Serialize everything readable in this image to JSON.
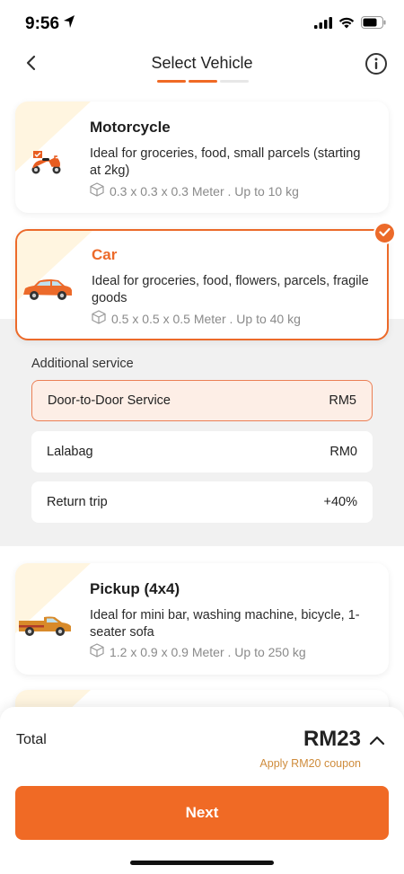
{
  "status": {
    "time": "9:56"
  },
  "header": {
    "title": "Select Vehicle"
  },
  "vehicles": [
    {
      "name": "Motorcycle",
      "description": "Ideal for groceries, food, small parcels (starting at 2kg)",
      "spec": "0.3 x 0.3 x 0.3 Meter . Up to 10 kg"
    },
    {
      "name": "Car",
      "description": "Ideal for groceries, food, flowers, parcels, fragile goods",
      "spec": "0.5 x 0.5 x 0.5 Meter . Up to 40 kg"
    },
    {
      "name": "Pickup (4x4)",
      "description": "Ideal for mini bar, washing machine, bicycle, 1-seater sofa",
      "spec": "1.2 x 0.9 x 0.9 Meter . Up to 250 kg"
    }
  ],
  "additional": {
    "title": "Additional service",
    "services": [
      {
        "label": "Door-to-Door Service",
        "price": "RM5"
      },
      {
        "label": "Lalabag",
        "price": "RM0"
      },
      {
        "label": "Return trip",
        "price": "+40%"
      }
    ]
  },
  "footer": {
    "total_label": "Total",
    "total_amount": "RM23",
    "coupon_text": "Apply RM20 coupon",
    "next_label": "Next"
  },
  "colors": {
    "accent": "#f06a25",
    "coupon": "#cf8c3c",
    "tint": "#fff5e0"
  },
  "icons": [
    "location-arrow-icon",
    "signal-icon",
    "wifi-icon",
    "battery-icon",
    "back-chevron-icon",
    "info-icon",
    "motorcycle-icon",
    "car-icon",
    "pickup-truck-icon",
    "box-icon",
    "check-icon",
    "chevron-up-icon"
  ]
}
